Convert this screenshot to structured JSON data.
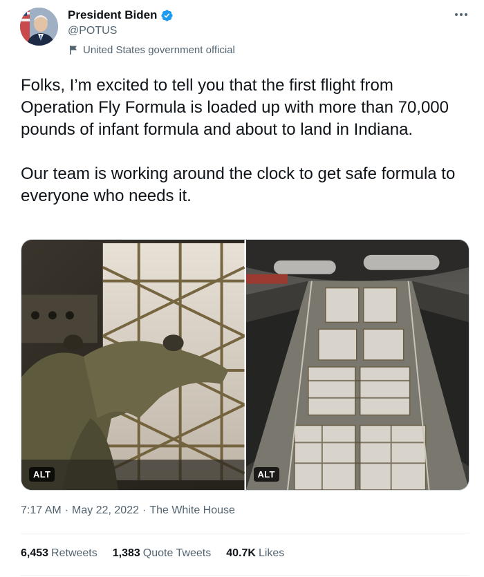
{
  "author": {
    "display_name": "President Biden",
    "handle": "@POTUS",
    "label": "United States government official",
    "avatar": "avatar-photo",
    "verified_icon": "verified-badge-icon",
    "label_icon": "flag-icon"
  },
  "tweet": {
    "paragraphs": [
      "Folks, I’m excited to tell you that the first flight from Operation Fly Formula is loaded up with more than 70,000 pounds of infant formula and about to land in Indiana.",
      "Our team is working around the clock to get safe formula to everyone who needs it."
    ]
  },
  "media": {
    "photos": [
      {
        "alt_label": "ALT",
        "subject": "soldiers-loading-cargo"
      },
      {
        "alt_label": "ALT",
        "subject": "cargo-hold-pallets"
      }
    ]
  },
  "meta": {
    "time": "7:17 AM",
    "separator": "·",
    "date": "May 22, 2022",
    "source": "The White House"
  },
  "stats": [
    {
      "num": "6,453",
      "label": "Retweets"
    },
    {
      "num": "1,383",
      "label": "Quote Tweets"
    },
    {
      "num": "40.7K",
      "label": "Likes"
    }
  ],
  "colors": {
    "text": "#0f1419",
    "secondary": "#536471",
    "verified": "#1d9bf0",
    "divider": "#eff3f4"
  }
}
